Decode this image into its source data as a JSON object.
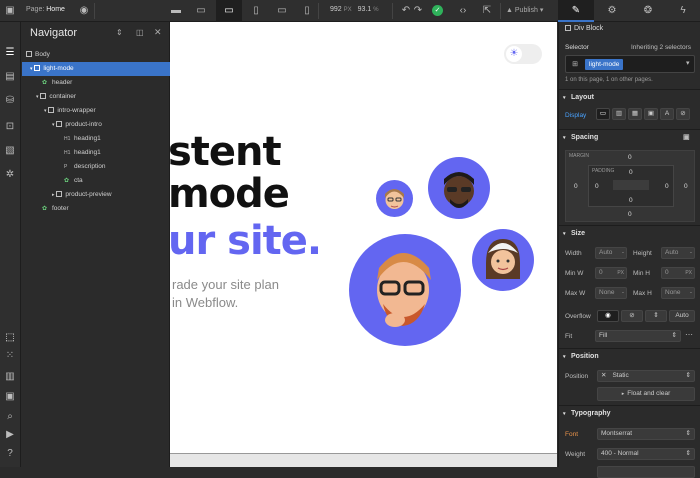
{
  "topbar": {
    "page_label": "Page:",
    "page_name": "Home",
    "width_value": "992",
    "width_unit": "PX",
    "zoom": "93.1",
    "zoom_unit": "%",
    "publish_label": "Publish"
  },
  "navigator": {
    "title": "Navigator",
    "items": [
      {
        "label": "Body",
        "depth": 0
      },
      {
        "label": "light-mode",
        "depth": 1
      },
      {
        "label": "header",
        "depth": 2
      },
      {
        "label": "container",
        "depth": 2
      },
      {
        "label": "intro-wrapper",
        "depth": 3
      },
      {
        "label": "product-intro",
        "depth": 4
      },
      {
        "label": "heading1",
        "depth": 5
      },
      {
        "label": "heading1",
        "depth": 5
      },
      {
        "label": "description",
        "depth": 5
      },
      {
        "label": "cta",
        "depth": 5
      },
      {
        "label": "product-preview",
        "depth": 4
      },
      {
        "label": "footer",
        "depth": 2
      }
    ]
  },
  "canvas": {
    "line1": "stent",
    "line2": "mode",
    "line3": "ur site.",
    "sub1": "rade your site plan",
    "sub2": "in Webflow."
  },
  "rightpanel": {
    "element_type": "Div Block",
    "selector_label": "Selector",
    "inheriting": "Inheriting 2 selectors",
    "selector_chip": "light-mode",
    "on_page": "1 on this page, 1 on other pages.",
    "layout": {
      "title": "Layout",
      "display_label": "Display"
    },
    "spacing": {
      "title": "Spacing",
      "margin_label": "MARGIN",
      "padding_label": "PADDING",
      "margin_top": "0",
      "margin_left": "0",
      "margin_right": "0",
      "margin_bottom": "0",
      "padding_top": "0",
      "padding_left": "0",
      "padding_right": "0",
      "padding_bottom": "0"
    },
    "size": {
      "title": "Size",
      "width_label": "Width",
      "width_value": "Auto",
      "width_unit": "-",
      "height_label": "Height",
      "height_value": "Auto",
      "height_unit": "-",
      "minw_label": "Min W",
      "minw_value": "0",
      "minw_unit": "PX",
      "minh_label": "Min H",
      "minh_value": "0",
      "minh_unit": "PX",
      "maxw_label": "Max W",
      "maxw_value": "None",
      "maxw_unit": "-",
      "maxh_label": "Max H",
      "maxh_value": "None",
      "maxh_unit": "-",
      "overflow_label": "Overflow",
      "overflow_auto": "Auto",
      "fit_label": "Fit",
      "fit_value": "Fill"
    },
    "position": {
      "title": "Position",
      "position_label": "Position",
      "position_value": "Static",
      "float_label": "Float and clear"
    },
    "typography": {
      "title": "Typography",
      "font_label": "Font",
      "font_value": "Montserrat",
      "weight_label": "Weight",
      "weight_value": "400 - Normal"
    }
  },
  "colors": {
    "accent_blue": "#3a74c9",
    "hero_purple": "#6366f1",
    "panel_bg": "#2b2b2b",
    "active_green": "#2fb25b"
  }
}
